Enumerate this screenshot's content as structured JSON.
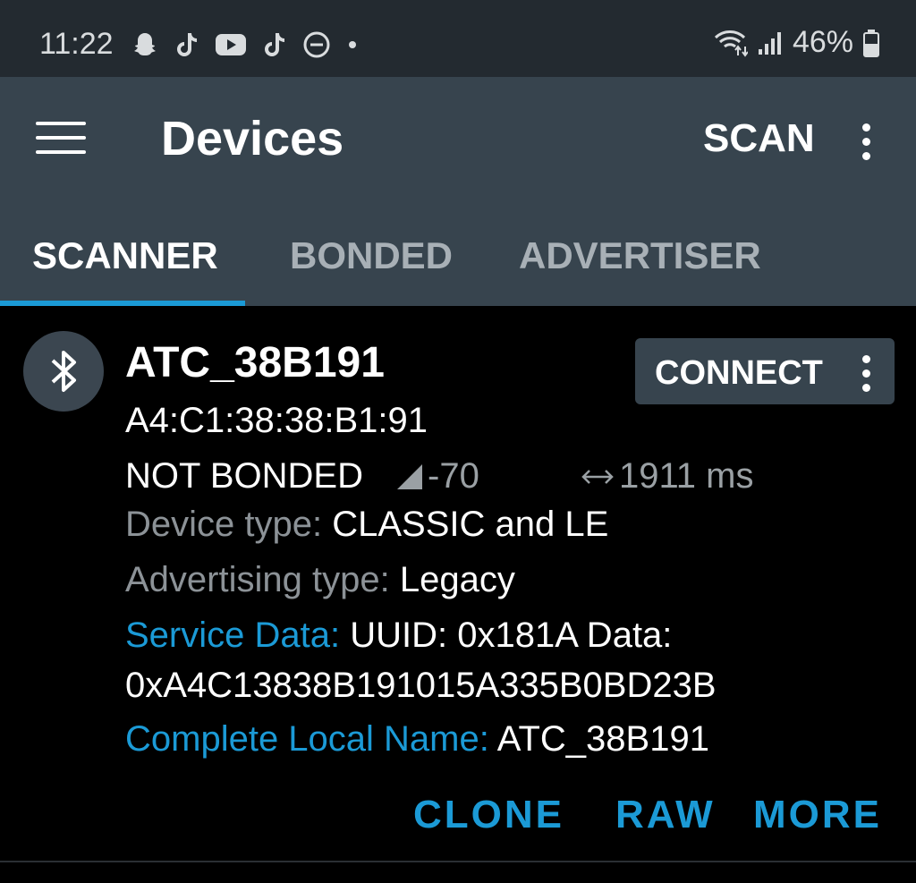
{
  "status_bar": {
    "time": "11:22",
    "battery": "46%",
    "icons": [
      "snapchat-icon",
      "tiktok-icon",
      "youtube-icon",
      "tiktok-icon",
      "do-not-disturb-icon",
      "dot-icon",
      "wifi-icon",
      "signal-icon",
      "battery-icon"
    ]
  },
  "appbar": {
    "title": "Devices",
    "scan_label": "SCAN"
  },
  "tabs": [
    {
      "label": "SCANNER",
      "active": true
    },
    {
      "label": "BONDED",
      "active": false
    },
    {
      "label": "ADVERTISER",
      "active": false
    }
  ],
  "device": {
    "name": "ATC_38B191",
    "mac": "A4:C1:38:38:B1:91",
    "bond_state": "NOT BONDED",
    "rssi": "-70",
    "interval": "1911 ms",
    "device_type_label": "Device type:",
    "device_type": "CLASSIC and LE",
    "advertising_type_label": "Advertising type:",
    "advertising_type": "Legacy",
    "service_data_label": "Service Data:",
    "service_data_line1": "UUID: 0x181A Data:",
    "service_data_line2": "0xA4C13838B191015A335B0BD23B",
    "local_name_label": "Complete Local Name:",
    "local_name": "ATC_38B191",
    "connect_label": "CONNECT"
  },
  "actions": {
    "clone": "CLONE",
    "raw": "RAW",
    "more": "MORE"
  },
  "colors": {
    "accent": "#1b9ad6",
    "appbar": "#37444e",
    "statusbar": "#232a30"
  }
}
